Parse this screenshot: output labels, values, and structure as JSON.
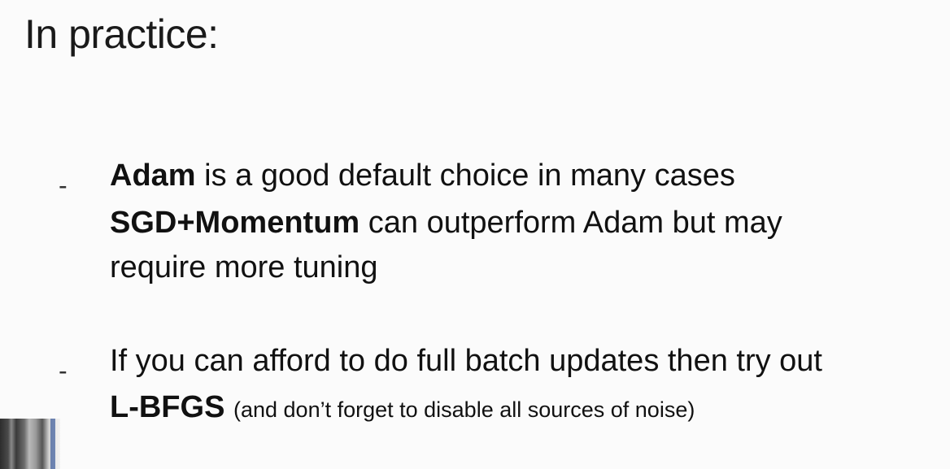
{
  "slide": {
    "title": "In practice:",
    "bullet_marker": "-",
    "bullets": [
      {
        "lines": [
          {
            "bold": "Adam",
            "text": " is a good default choice in many cases"
          },
          {
            "bold": "SGD+Momentum",
            "text": " can outperform Adam but may"
          },
          {
            "bold": "",
            "text": "require more tuning"
          }
        ]
      },
      {
        "lines": [
          {
            "bold": "",
            "text": "If you can afford to do full batch updates then try out"
          },
          {
            "bold": "L-BFGS",
            "text": "",
            "small": "(and don’t forget to disable all sources of noise)"
          }
        ]
      }
    ]
  }
}
